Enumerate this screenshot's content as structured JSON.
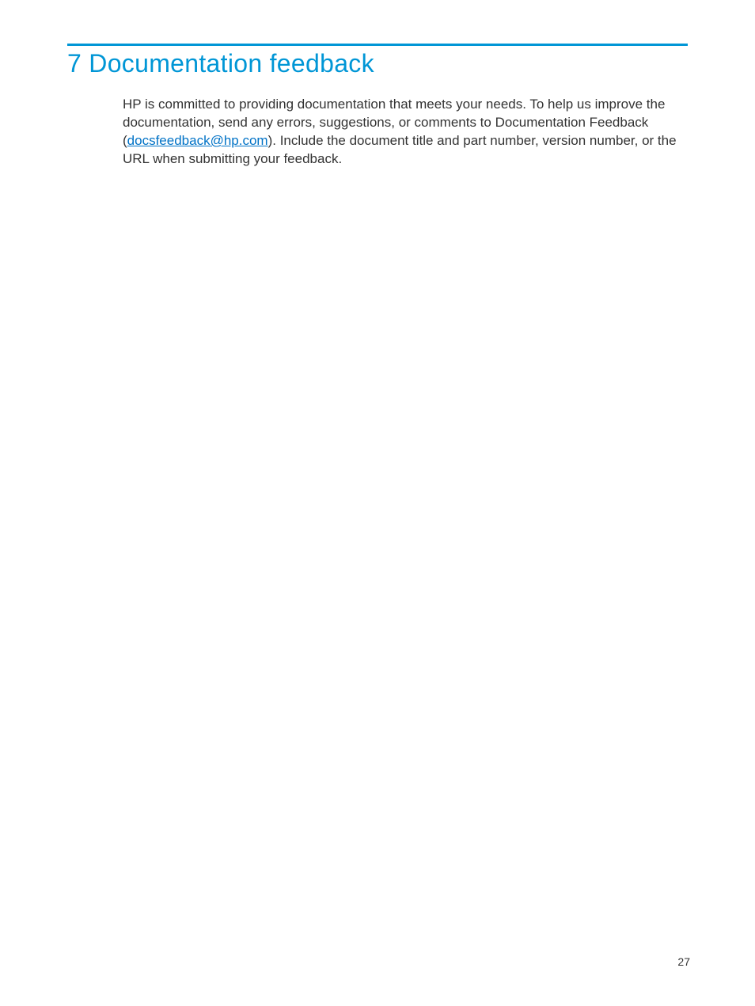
{
  "chapter": {
    "title": "7 Documentation feedback"
  },
  "body": {
    "text_before_link": "HP is committed to providing documentation that meets your needs. To help us improve the documentation, send any errors, suggestions, or comments to Documentation Feedback (",
    "link_text": "docsfeedback@hp.com",
    "text_after_link": "). Include the document title and part number, version number, or the URL when submitting your feedback."
  },
  "page_number": "27"
}
